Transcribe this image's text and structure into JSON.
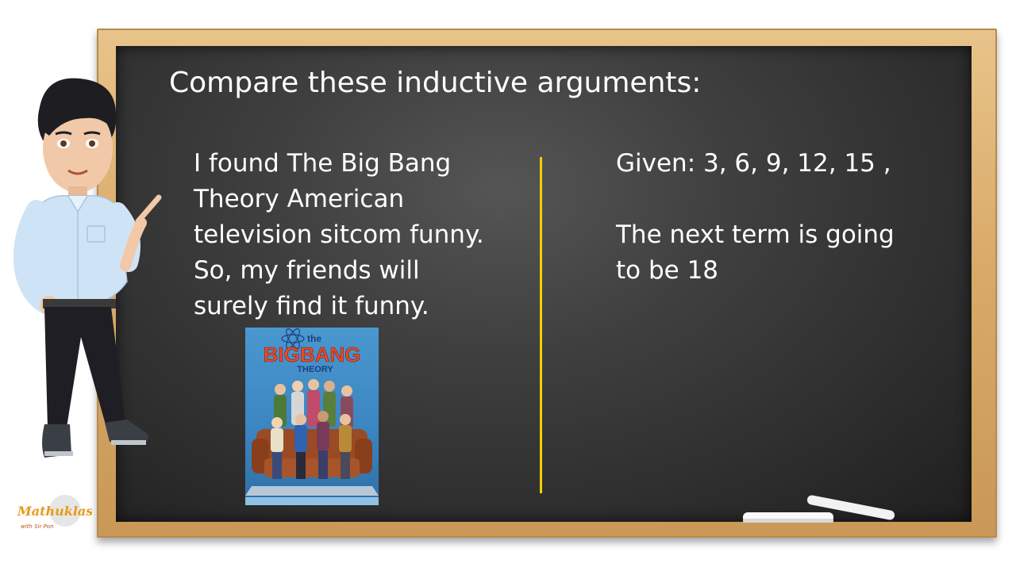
{
  "slide": {
    "title": "Compare these inductive arguments:",
    "left_argument": {
      "lines": [
        "I found The Big Bang",
        "Theory American",
        "television sitcom funny.",
        "So, my friends will",
        "surely find it funny."
      ]
    },
    "right_argument": {
      "lines": [
        "Given: 3, 6, 9, 12, 15 ,",
        "",
        "The next term is going",
        "to be 18"
      ]
    },
    "poster": {
      "title_line1": "the",
      "title_line2": "BIGBANG",
      "title_line3": "THEORY"
    },
    "logo": {
      "text": "Mathuklasan",
      "subtext": "with Sir Pon"
    }
  },
  "colors": {
    "divider": "#f3d000",
    "frame": "#d9ab6a",
    "board": "#3a3a3a",
    "text": "#ffffff"
  },
  "icons": {
    "teacher": "teacher-avatar-icon",
    "chalk": "chalk-icon",
    "logo": "mathuklasan-logo"
  }
}
